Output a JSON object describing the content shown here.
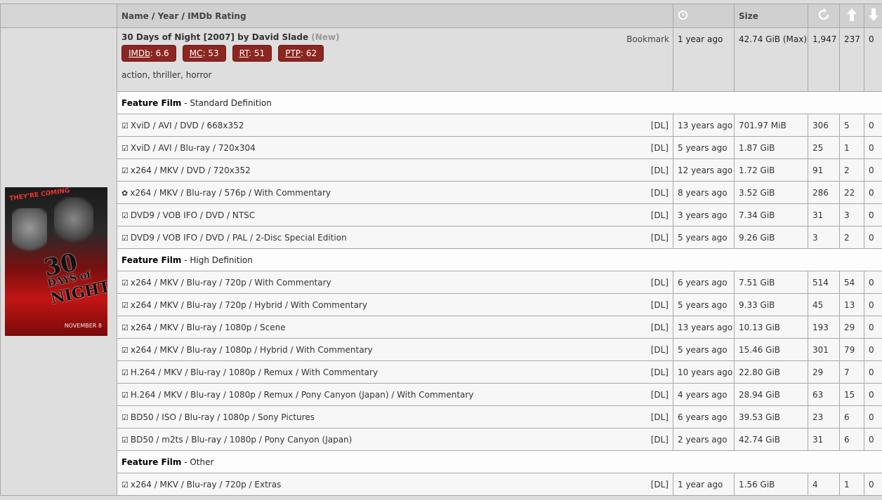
{
  "header": {
    "col_name": "Name",
    "sep": "/",
    "col_year": "Year",
    "col_imdb": "IMDb Rating",
    "col_size": "Size"
  },
  "movie": {
    "title": "30 Days of Night",
    "year": "[2007]",
    "by": "by",
    "director": "David Slade",
    "new_tag": "(New)",
    "bookmark": "Bookmark",
    "ratings": [
      {
        "label": "IMDb",
        "value": ": 6.6"
      },
      {
        "label": "MC",
        "value": ": 53"
      },
      {
        "label": "RT",
        "value": ": 51"
      },
      {
        "label": "PTP",
        "value": ": 62"
      }
    ],
    "tags": [
      "action",
      "thriller",
      "horror"
    ],
    "tag_sep": ", ",
    "time": "1 year ago",
    "size": "42.74 GiB (Max)",
    "snatched": "1,947",
    "seeders": "237",
    "leechers": "0",
    "poster": {
      "tagline": "THEY'RE COMING",
      "title_line1": "30",
      "title_line2": "DAYS of",
      "title_line3": "NIGHT",
      "date": "NOVEMBER 8"
    }
  },
  "groups": [
    {
      "type": "Feature Film",
      "sub": " - Standard Definition",
      "rows": [
        {
          "mark": "☑",
          "name": "XviD / AVI / DVD / 668x352",
          "dl": "[DL]",
          "time": "13 years ago",
          "size": "701.97 MiB",
          "snatched": "306",
          "seeders": "5",
          "leechers": "0"
        },
        {
          "mark": "☑",
          "name": "XviD / AVI / Blu-ray / 720x304",
          "dl": "[DL]",
          "time": "5 years ago",
          "size": "1.87 GiB",
          "snatched": "25",
          "seeders": "1",
          "leechers": "0"
        },
        {
          "mark": "☑",
          "name": "x264 / MKV / DVD / 720x352",
          "dl": "[DL]",
          "time": "12 years ago",
          "size": "1.72 GiB",
          "snatched": "91",
          "seeders": "2",
          "leechers": "0"
        },
        {
          "mark": "✿",
          "name": "x264 / MKV / Blu-ray / 576p / With Commentary",
          "dl": "[DL]",
          "time": "8 years ago",
          "size": "3.52 GiB",
          "snatched": "286",
          "seeders": "22",
          "leechers": "0"
        },
        {
          "mark": "☑",
          "name": "DVD9 / VOB IFO / DVD / NTSC",
          "dl": "[DL]",
          "time": "3 years ago",
          "size": "7.34 GiB",
          "snatched": "31",
          "seeders": "3",
          "leechers": "0"
        },
        {
          "mark": "☑",
          "name": "DVD9 / VOB IFO / DVD / PAL / 2-Disc Special Edition",
          "dl": "[DL]",
          "time": "5 years ago",
          "size": "9.26 GiB",
          "snatched": "3",
          "seeders": "2",
          "leechers": "0"
        }
      ]
    },
    {
      "type": "Feature Film",
      "sub": " - High Definition",
      "rows": [
        {
          "mark": "☑",
          "name": "x264 / MKV / Blu-ray / 720p / With Commentary",
          "dl": "[DL]",
          "time": "6 years ago",
          "size": "7.51 GiB",
          "snatched": "514",
          "seeders": "54",
          "leechers": "0"
        },
        {
          "mark": "☑",
          "name": "x264 / MKV / Blu-ray / 720p / Hybrid / With Commentary",
          "dl": "[DL]",
          "time": "5 years ago",
          "size": "9.33 GiB",
          "snatched": "45",
          "seeders": "13",
          "leechers": "0"
        },
        {
          "mark": "☑",
          "name": "x264 / MKV / Blu-ray / 1080p / Scene",
          "dl": "[DL]",
          "time": "13 years ago",
          "size": "10.13 GiB",
          "snatched": "193",
          "seeders": "29",
          "leechers": "0"
        },
        {
          "mark": "☑",
          "name": "x264 / MKV / Blu-ray / 1080p / Hybrid / With Commentary",
          "dl": "[DL]",
          "time": "5 years ago",
          "size": "15.46 GiB",
          "snatched": "301",
          "seeders": "79",
          "leechers": "0"
        },
        {
          "mark": "☑",
          "name": "H.264 / MKV / Blu-ray / 1080p / Remux / With Commentary",
          "dl": "[DL]",
          "time": "10 years ago",
          "size": "22.80 GiB",
          "snatched": "29",
          "seeders": "7",
          "leechers": "0"
        },
        {
          "mark": "☑",
          "name": "H.264 / MKV / Blu-ray / 1080p / Remux / Pony Canyon (Japan) / With Commentary",
          "dl": "[DL]",
          "time": "4 years ago",
          "size": "28.94 GiB",
          "snatched": "63",
          "seeders": "15",
          "leechers": "0"
        },
        {
          "mark": "☑",
          "name": "BD50 / ISO / Blu-ray / 1080p / Sony Pictures",
          "dl": "[DL]",
          "time": "6 years ago",
          "size": "39.53 GiB",
          "snatched": "23",
          "seeders": "6",
          "leechers": "0"
        },
        {
          "mark": "☑",
          "name": "BD50 / m2ts / Blu-ray / 1080p / Pony Canyon (Japan)",
          "dl": "[DL]",
          "time": "2 years ago",
          "size": "42.74 GiB",
          "snatched": "31",
          "seeders": "6",
          "leechers": "0"
        }
      ]
    },
    {
      "type": "Feature Film",
      "sub": " - Other",
      "rows": [
        {
          "mark": "☑",
          "name": "x264 / MKV / Blu-ray / 720p / Extras",
          "dl": "[DL]",
          "time": "1 year ago",
          "size": "1.56 GiB",
          "snatched": "4",
          "seeders": "1",
          "leechers": "0"
        }
      ]
    }
  ]
}
